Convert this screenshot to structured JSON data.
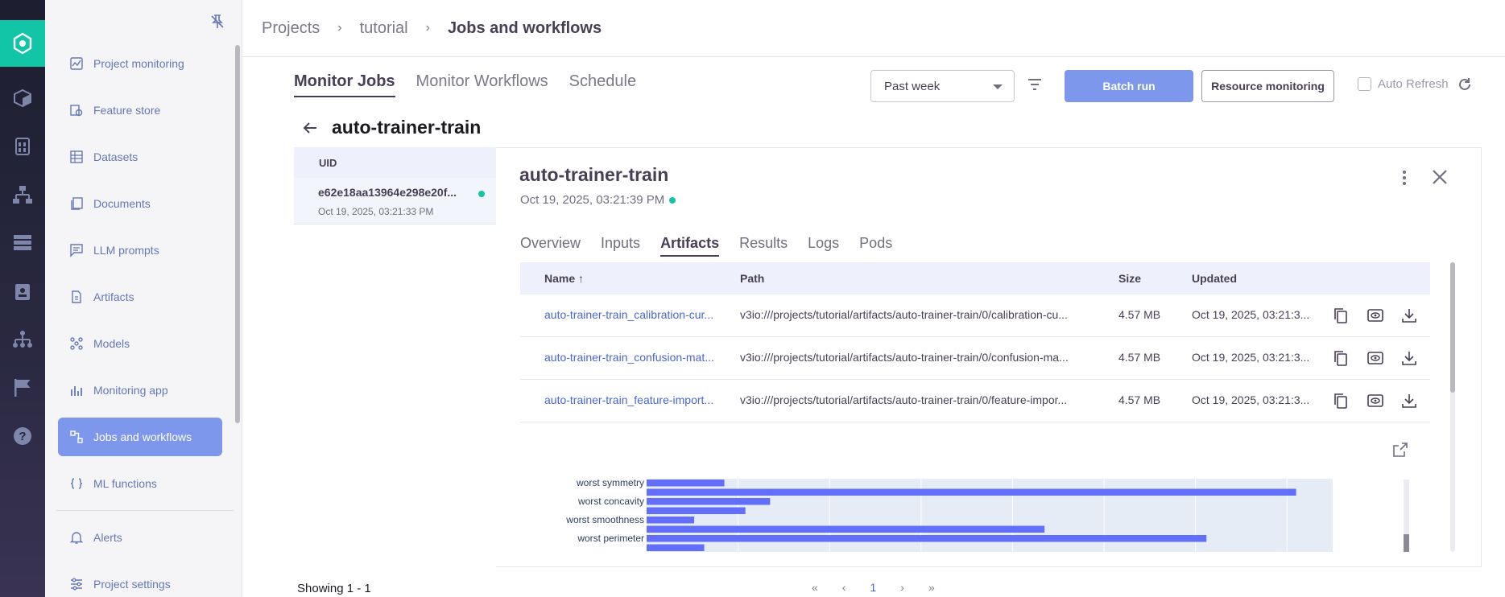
{
  "nav": {
    "items": [
      {
        "label": "Project monitoring",
        "icon": "monitoring-icon"
      },
      {
        "label": "Feature store",
        "icon": "feature-store-icon"
      },
      {
        "label": "Datasets",
        "icon": "datasets-icon"
      },
      {
        "label": "Documents",
        "icon": "documents-icon"
      },
      {
        "label": "LLM prompts",
        "icon": "llm-prompts-icon"
      },
      {
        "label": "Artifacts",
        "icon": "artifacts-icon"
      },
      {
        "label": "Models",
        "icon": "models-icon"
      },
      {
        "label": "Monitoring app",
        "icon": "monitoring-app-icon"
      },
      {
        "label": "Jobs and workflows",
        "icon": "jobs-icon",
        "active": true
      },
      {
        "label": "ML functions",
        "icon": "ml-functions-icon"
      },
      {
        "label": "Alerts",
        "icon": "bell-icon"
      },
      {
        "label": "Project settings",
        "icon": "settings-icon"
      }
    ]
  },
  "breadcrumb": {
    "projects": "Projects",
    "sep1": "›",
    "project": "tutorial",
    "sep2": "›",
    "current": "Jobs and workflows"
  },
  "tabs": {
    "monitor_jobs": "Monitor Jobs",
    "monitor_workflows": "Monitor Workflows",
    "schedule": "Schedule"
  },
  "toolbar": {
    "date_filter": "Past week",
    "batch_run": "Batch run",
    "resource_monitoring": "Resource monitoring",
    "auto_refresh": "Auto Refresh"
  },
  "page_title": "auto-trainer-train",
  "job_list": {
    "header": "UID",
    "row": {
      "uid": "e62e18aa13964e298e20f...",
      "date": "Oct 19, 2025, 03:21:33 PM"
    }
  },
  "detail": {
    "title": "auto-trainer-train",
    "date": "Oct 19, 2025, 03:21:39 PM",
    "tabs": [
      "Overview",
      "Inputs",
      "Artifacts",
      "Results",
      "Logs",
      "Pods"
    ],
    "active_tab": "Artifacts"
  },
  "artifacts_table": {
    "headers": {
      "name": "Name ↑",
      "path": "Path",
      "size": "Size",
      "updated": "Updated"
    },
    "rows": [
      {
        "name": "auto-trainer-train_calibration-cur...",
        "path": "v3io:///projects/tutorial/artifacts/auto-trainer-train/0/calibration-cu...",
        "size": "4.57 MB",
        "updated": "Oct 19, 2025, 03:21:3..."
      },
      {
        "name": "auto-trainer-train_confusion-mat...",
        "path": "v3io:///projects/tutorial/artifacts/auto-trainer-train/0/confusion-ma...",
        "size": "4.57 MB",
        "updated": "Oct 19, 2025, 03:21:3..."
      },
      {
        "name": "auto-trainer-train_feature-import...",
        "path": "v3io:///projects/tutorial/artifacts/auto-trainer-train/0/feature-impor...",
        "size": "4.57 MB",
        "updated": "Oct 19, 2025, 03:21:3..."
      }
    ]
  },
  "chart_data": {
    "type": "bar",
    "orientation": "horizontal",
    "categories": [
      "worst symmetry",
      "",
      "worst concavity",
      "",
      "worst smoothness",
      "",
      "worst perimeter",
      ""
    ],
    "values": [
      0.085,
      0.71,
      0.135,
      0.108,
      0.052,
      0.435,
      0.612,
      0.063
    ],
    "xlim": [
      0,
      0.75
    ],
    "grid": true,
    "colors": {
      "bar": "#636efa",
      "plot_bg": "#e5ecf6"
    }
  },
  "pagination": {
    "showing": "Showing 1 - 1",
    "first": "«",
    "prev": "‹",
    "page": "1",
    "next": "›",
    "last": "»"
  },
  "colors": {
    "accent": "#7c97eb",
    "brand": "#12c5a6",
    "link": "#4866d3"
  }
}
